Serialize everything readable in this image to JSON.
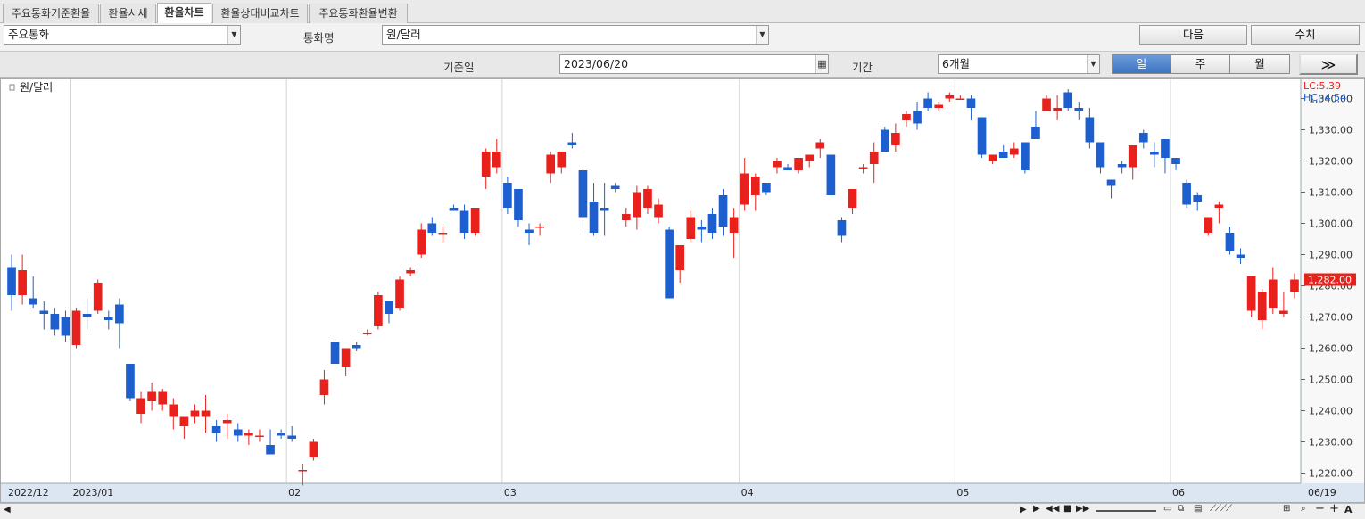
{
  "tabs": [
    {
      "label": "주요통화기준환율",
      "active": false
    },
    {
      "label": "환율시세",
      "active": false
    },
    {
      "label": "환율차트",
      "active": true
    },
    {
      "label": "환율상대비교차트",
      "active": false
    },
    {
      "label": "주요통화환율변환",
      "active": false
    }
  ],
  "controls": {
    "currency_group": "주요통화",
    "currency_name_label": "통화명",
    "currency_name": "원/달러",
    "next_button": "다음",
    "numeric_button": "수치",
    "base_date_label": "기준일",
    "base_date": "2023/06/20",
    "period_label": "기간",
    "period": "6개월",
    "interval": {
      "day": "일",
      "week": "주",
      "month": "월",
      "selected": "day"
    },
    "go_button": "≫"
  },
  "colors": {
    "up": "#e8211c",
    "down": "#1e5fd0",
    "selected_segment": "#4a80cc"
  },
  "chart_data": {
    "type": "candlestick",
    "title": "원/달러",
    "legend": [
      "LC:5.39",
      "HC:-4.54"
    ],
    "last_value_label": "1,282.00",
    "y_ticks": [
      "1,340.00",
      "1,330.00",
      "1,320.00",
      "1,310.00",
      "1,300.00",
      "1,290.00",
      "1,280.00",
      "1,270.00",
      "1,260.00",
      "1,250.00",
      "1,240.00",
      "1,230.00",
      "1,220.00"
    ],
    "ylim": [
      1217,
      1345
    ],
    "x_labels": [
      {
        "label": "2022/12",
        "index": 0
      },
      {
        "label": "2023/01",
        "index": 6
      },
      {
        "label": "02",
        "index": 26
      },
      {
        "label": "03",
        "index": 46
      },
      {
        "label": "04",
        "index": 68
      },
      {
        "label": "05",
        "index": 88
      },
      {
        "label": "06",
        "index": 108
      },
      {
        "label": "06/19",
        "index": 120
      }
    ],
    "candles": [
      [
        1286,
        1290,
        1272,
        1277
      ],
      [
        1277,
        1290,
        1274,
        1285
      ],
      [
        1276,
        1283,
        1273,
        1274
      ],
      [
        1272,
        1275,
        1266,
        1271
      ],
      [
        1271,
        1273,
        1264,
        1266
      ],
      [
        1270,
        1272,
        1262,
        1264
      ],
      [
        1261,
        1273,
        1260,
        1272
      ],
      [
        1271,
        1276,
        1266,
        1270
      ],
      [
        1272,
        1282,
        1271,
        1281
      ],
      [
        1270,
        1272,
        1266,
        1269
      ],
      [
        1274,
        1276,
        1260,
        1268
      ],
      [
        1255,
        1255,
        1243,
        1244
      ],
      [
        1239,
        1246,
        1236,
        1244
      ],
      [
        1243,
        1249,
        1240,
        1246
      ],
      [
        1242,
        1247,
        1240,
        1246
      ],
      [
        1238,
        1244,
        1234,
        1242
      ],
      [
        1235,
        1238,
        1231,
        1238
      ],
      [
        1238,
        1242,
        1236,
        1240
      ],
      [
        1238,
        1245,
        1233,
        1240
      ],
      [
        1235,
        1237,
        1230,
        1233
      ],
      [
        1236,
        1239,
        1231,
        1237
      ],
      [
        1234,
        1236,
        1230,
        1232
      ],
      [
        1232,
        1234,
        1229,
        1233
      ],
      [
        1232,
        1234,
        1230,
        1232
      ],
      [
        1229,
        1234,
        1226,
        1226
      ],
      [
        1233,
        1234,
        1231,
        1232
      ],
      [
        1232,
        1235,
        1230,
        1231
      ],
      [
        1221,
        1223,
        1216,
        1221
      ],
      [
        1225,
        1231,
        1224,
        1230
      ],
      [
        1245,
        1253,
        1242,
        1250
      ],
      [
        1262,
        1263,
        1255,
        1255
      ],
      [
        1254,
        1258,
        1251,
        1260
      ],
      [
        1261,
        1262,
        1259,
        1260
      ],
      [
        1265,
        1266,
        1264,
        1265
      ],
      [
        1267,
        1278,
        1266,
        1277
      ],
      [
        1275,
        1275,
        1268,
        1271
      ],
      [
        1273,
        1283,
        1272,
        1282
      ],
      [
        1284,
        1286,
        1283,
        1285
      ],
      [
        1290,
        1300,
        1289,
        1298
      ],
      [
        1300,
        1302,
        1296,
        1297
      ],
      [
        1297,
        1299,
        1294,
        1297
      ],
      [
        1305,
        1306,
        1304,
        1304
      ],
      [
        1304,
        1306,
        1295,
        1297
      ],
      [
        1297,
        1305,
        1296,
        1305
      ],
      [
        1315,
        1324,
        1311,
        1323
      ],
      [
        1318,
        1327,
        1316,
        1323
      ],
      [
        1313,
        1315,
        1303,
        1305
      ],
      [
        1311,
        1311,
        1299,
        1301
      ],
      [
        1298,
        1300,
        1293,
        1297
      ],
      [
        1299,
        1300,
        1296,
        1299
      ],
      [
        1316,
        1323,
        1313,
        1322
      ],
      [
        1318,
        1323,
        1316,
        1323
      ],
      [
        1326,
        1329,
        1324,
        1325
      ],
      [
        1317,
        1318,
        1298,
        1302
      ],
      [
        1307,
        1313,
        1296,
        1297
      ],
      [
        1305,
        1313,
        1296,
        1304
      ],
      [
        1312,
        1313,
        1310,
        1311
      ],
      [
        1301,
        1305,
        1299,
        1303
      ],
      [
        1302,
        1312,
        1298,
        1310
      ],
      [
        1305,
        1312,
        1303,
        1311
      ],
      [
        1302,
        1308,
        1300,
        1306
      ],
      [
        1298,
        1299,
        1276,
        1276
      ],
      [
        1285,
        1292,
        1281,
        1293
      ],
      [
        1295,
        1304,
        1294,
        1302
      ],
      [
        1299,
        1301,
        1294,
        1298
      ],
      [
        1303,
        1305,
        1295,
        1297
      ],
      [
        1309,
        1311,
        1296,
        1299
      ],
      [
        1297,
        1305,
        1289,
        1302
      ],
      [
        1306,
        1321,
        1304,
        1316
      ],
      [
        1309,
        1316,
        1304,
        1315
      ],
      [
        1313,
        1313,
        1309,
        1310
      ],
      [
        1318,
        1321,
        1316,
        1320
      ],
      [
        1318,
        1319,
        1317,
        1317
      ],
      [
        1317,
        1321,
        1316,
        1321
      ],
      [
        1320,
        1320,
        1318,
        1322
      ],
      [
        1324,
        1327,
        1321,
        1326
      ],
      [
        1322,
        1322,
        1309,
        1309
      ],
      [
        1301,
        1302,
        1294,
        1296
      ],
      [
        1305,
        1310,
        1303,
        1311
      ],
      [
        1318,
        1319,
        1316,
        1318
      ],
      [
        1319,
        1326,
        1313,
        1323
      ],
      [
        1330,
        1331,
        1324,
        1323
      ],
      [
        1325,
        1332,
        1323,
        1329
      ],
      [
        1333,
        1336,
        1331,
        1335
      ],
      [
        1336,
        1339,
        1330,
        1332
      ],
      [
        1340,
        1342,
        1336,
        1337
      ],
      [
        1337,
        1339,
        1336,
        1338
      ],
      [
        1340,
        1342,
        1339,
        1341
      ],
      [
        1340,
        1341,
        1340,
        1340
      ],
      [
        1340,
        1341,
        1333,
        1337
      ],
      [
        1334,
        1334,
        1321,
        1322
      ],
      [
        1320,
        1322,
        1319,
        1322
      ],
      [
        1323,
        1325,
        1322,
        1321
      ],
      [
        1322,
        1326,
        1321,
        1324
      ],
      [
        1326,
        1326,
        1316,
        1317
      ],
      [
        1331,
        1336,
        1329,
        1327
      ],
      [
        1336,
        1341,
        1336,
        1340
      ],
      [
        1336,
        1341,
        1333,
        1337
      ],
      [
        1342,
        1343,
        1336,
        1337
      ],
      [
        1337,
        1339,
        1333,
        1336
      ],
      [
        1334,
        1337,
        1324,
        1326
      ],
      [
        1326,
        1326,
        1316,
        1318
      ],
      [
        1314,
        1314,
        1308,
        1312
      ],
      [
        1319,
        1320,
        1316,
        1318
      ],
      [
        1318,
        1325,
        1314,
        1325
      ],
      [
        1329,
        1330,
        1324,
        1326
      ],
      [
        1323,
        1326,
        1318,
        1322
      ],
      [
        1327,
        1327,
        1316,
        1321
      ],
      [
        1321,
        1321,
        1317,
        1319
      ],
      [
        1313,
        1314,
        1305,
        1306
      ],
      [
        1309,
        1310,
        1304,
        1307
      ],
      [
        1297,
        1302,
        1296,
        1302
      ],
      [
        1305,
        1307,
        1300,
        1306
      ],
      [
        1297,
        1299,
        1290,
        1291
      ],
      [
        1290,
        1292,
        1287,
        1289
      ],
      [
        1272,
        1281,
        1270,
        1283
      ],
      [
        1269,
        1279,
        1266,
        1278
      ],
      [
        1273,
        1286,
        1271,
        1282
      ],
      [
        1271,
        1278,
        1270,
        1272
      ],
      [
        1278,
        1284,
        1276,
        1282
      ]
    ]
  }
}
